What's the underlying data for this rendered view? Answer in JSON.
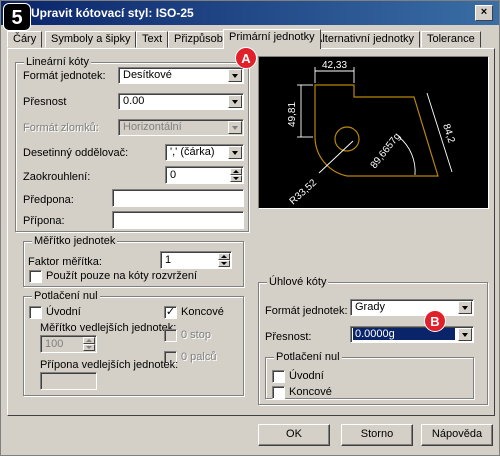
{
  "step_badge": "5",
  "window": {
    "title": "Upravit kótovací styl: ISO-25",
    "close_glyph": "×"
  },
  "tabs": [
    "Čáry",
    "Symboly a šipky",
    "Text",
    "Přizpůsobit",
    "Primární jednotky",
    "Alternativní jednotky",
    "Tolerance"
  ],
  "markers": {
    "a": "A",
    "b": "B"
  },
  "linear": {
    "title": "Lineární kóty",
    "unit_format": {
      "label": "Formát jednotek:",
      "value": "Desítkové"
    },
    "precision": {
      "label": "Přesnost",
      "value": "0.00"
    },
    "fraction_format": {
      "label": "Formát zlomků:",
      "value": "Horizontální"
    },
    "decimal_separator": {
      "label": "Desetinný oddělovač:",
      "value": "',' (čárka)"
    },
    "round_off": {
      "label": "Zaokrouhlení:",
      "value": "0"
    },
    "prefix": {
      "label": "Předpona:",
      "value": ""
    },
    "suffix": {
      "label": "Přípona:",
      "value": ""
    }
  },
  "scale": {
    "title": "Měřítko jednotek",
    "factor": {
      "label": "Faktor měřítka:",
      "value": "1"
    },
    "layout_only": {
      "label": "Použít pouze na kóty rozvržení",
      "checked": false
    }
  },
  "zero_suppress": {
    "title": "Potlačení nul",
    "leading": {
      "label": "Úvodní",
      "checked": false
    },
    "trailing": {
      "label": "Koncové",
      "checked": true,
      "mark": "✓"
    },
    "sub_units_factor": {
      "label": "Měřítko vedlejších jednotek:",
      "value": "100"
    },
    "zero_feet": {
      "label": "0 stop"
    },
    "zero_inches": {
      "label": "0 palců"
    },
    "sub_units_suffix": {
      "label": "Přípona vedlejších jednotek:",
      "value": ""
    }
  },
  "angular": {
    "title": "Úhlové kóty",
    "unit_format": {
      "label": "Formát jednotek:",
      "value": "Grady"
    },
    "precision": {
      "label": "Přesnost:",
      "value": "0.0000g"
    },
    "zero_suppress": {
      "title": "Potlačení nul",
      "leading": {
        "label": "Úvodní",
        "checked": false
      },
      "trailing": {
        "label": "Koncové",
        "checked": false
      }
    }
  },
  "preview": {
    "dim_top": "42,33",
    "dim_left": "49,81",
    "dim_right": "84,2",
    "dim_angle": "89,6657g",
    "dim_radius": "R33,52",
    "colors": {
      "geometry": "#b8860b",
      "dims": "#ffffff",
      "background": "#000000"
    }
  },
  "buttons": {
    "ok": "OK",
    "cancel": "Storno",
    "help": "Nápověda"
  }
}
